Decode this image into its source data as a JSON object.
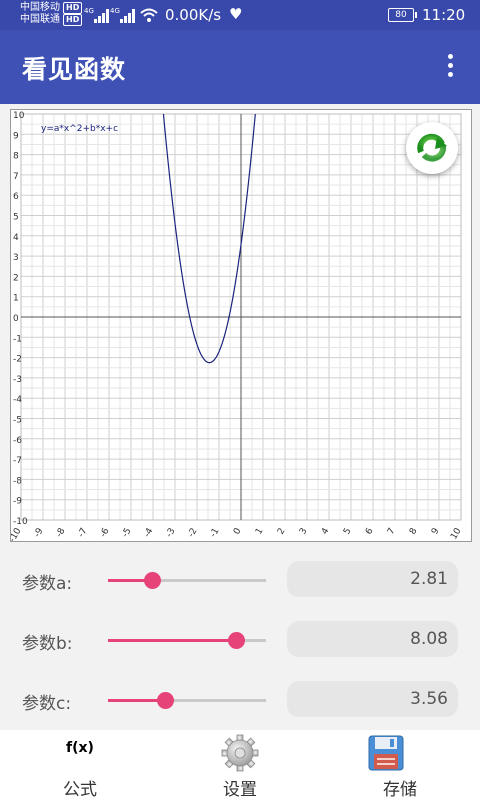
{
  "status": {
    "carrier1": "中国移动",
    "carrier2": "中国联通",
    "hd": "HD",
    "net": "4G",
    "speed": "0.00K/s",
    "battery": "80",
    "time": "11:20"
  },
  "appbar": {
    "title": "看见函数"
  },
  "chart_data": {
    "type": "line",
    "title": "",
    "annotation": "y=a*x^2+b*x+c",
    "xlabel": "",
    "ylabel": "",
    "xlim": [
      -10,
      10
    ],
    "ylim": [
      -10,
      10
    ],
    "grid": true,
    "x_ticks": [
      "-10",
      "-9",
      "-8",
      "-7",
      "-6",
      "-5",
      "-4",
      "-3",
      "-2",
      "-1",
      "0",
      "1",
      "2",
      "3",
      "4",
      "5",
      "6",
      "7",
      "8",
      "9",
      "10"
    ],
    "y_ticks": [
      "10",
      "9",
      "8",
      "7",
      "6",
      "5",
      "4",
      "3",
      "2",
      "1",
      "0",
      "-1",
      "-2",
      "-3",
      "-4",
      "-5",
      "-6",
      "-7",
      "-8",
      "-9",
      "-10"
    ],
    "series": [
      {
        "formula": "a*x^2+b*x+c",
        "a": 2.81,
        "b": 8.08,
        "c": 3.56,
        "color": "#1a237e"
      }
    ]
  },
  "params": [
    {
      "label": "参数a:",
      "value": "2.81",
      "fraction": 0.28
    },
    {
      "label": "参数b:",
      "value": "8.08",
      "fraction": 0.81
    },
    {
      "label": "参数c:",
      "value": "3.56",
      "fraction": 0.36
    }
  ],
  "colors": {
    "accent": "#e64378",
    "primary": "#3f51b5",
    "statusbar": "#3949ab"
  },
  "nav": {
    "formula_icon": "f(x)",
    "items": [
      {
        "label": "公式",
        "icon": "function-icon"
      },
      {
        "label": "设置",
        "icon": "gear-icon"
      },
      {
        "label": "存储",
        "icon": "floppy-disk-icon"
      }
    ]
  },
  "refresh_icon": "refresh-icon"
}
